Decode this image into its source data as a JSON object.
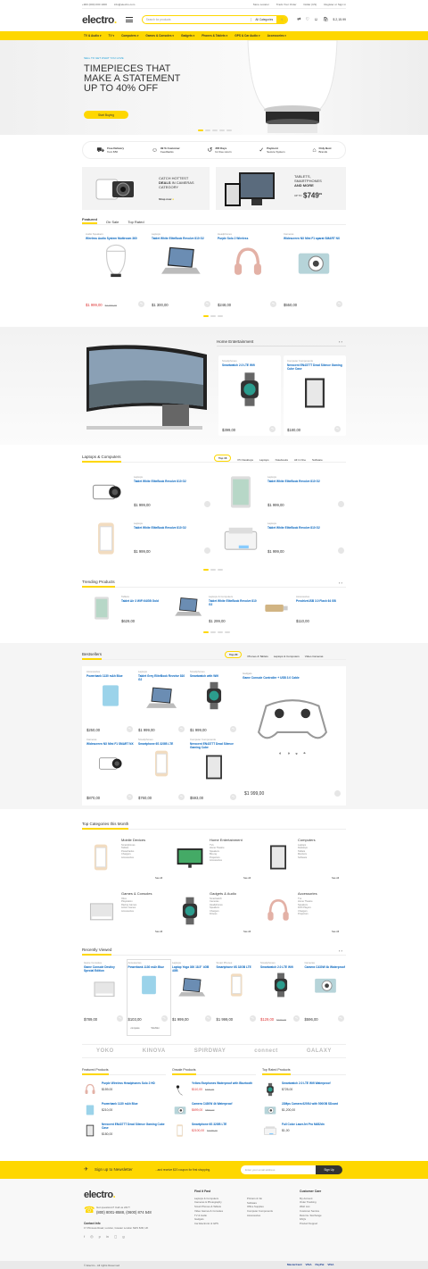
{
  "topbar": {
    "phone": "+900 (000) 000 1000",
    "email": "info@electro.com",
    "store": "Store Locator",
    "track": "Track Your Order",
    "currency": "Dollar (US)",
    "account": "Register  or  Sign in"
  },
  "header": {
    "logo": "electro",
    "search_placeholder": "Search for products",
    "categories": "All Categories",
    "cart_total": "$ 2,15.99",
    "cart_count": "2"
  },
  "nav": [
    "TV & Audio",
    "TV",
    "Computers",
    "Games & Consoles",
    "Gadgets",
    "Phones & Tablets",
    "GPS & Car Audio",
    "Accessories"
  ],
  "hero": {
    "kicker": "SELL TO GET WHAT YOU LOVE",
    "line1": "TIMEPIECES THAT",
    "line2": "MAKE A STATEMENT",
    "line3": "UP TO 40% OFF",
    "button": "Start Buying"
  },
  "features": [
    {
      "icon": "truck-icon",
      "l1": "Free Delivery",
      "l2": "from $50"
    },
    {
      "icon": "feedback-icon",
      "l1": "99 % Customer",
      "l2": "Feedbacks"
    },
    {
      "icon": "return-icon",
      "l1": "365 Days",
      "l2": "for free return"
    },
    {
      "icon": "payment-icon",
      "l1": "Payment",
      "l2": "Secure System"
    },
    {
      "icon": "tag-icon",
      "l1": "Only Best",
      "l2": "Brands"
    }
  ],
  "banners": [
    {
      "t1": "CATCH HOTTEST",
      "t2": "DEALS",
      "t3": " IN CAMERAS",
      "t4": "CATEGORY",
      "cta": "Shop now"
    },
    {
      "t1": "TABLETS,",
      "t2": "SMARTPHONES",
      "t3": "AND MORE",
      "from": "UP TO",
      "price": "$749",
      "cents": "99"
    }
  ],
  "featured": {
    "tabs": [
      "Featured",
      "On Sale",
      "Top Rated"
    ],
    "products": [
      {
        "cat": "Audio Speakers",
        "name": "Wireless Audio System Multiroom 360",
        "price": "$1 999,00",
        "old": "$2 299,00"
      },
      {
        "cat": "Laptops",
        "name": "Tablet White EliteBook Revolve 810 G2",
        "price": "$1 300,00"
      },
      {
        "cat": "Headphones",
        "name": "Purple Solo 2 Wireless",
        "price": "$248,00"
      },
      {
        "cat": "Cameras",
        "name": "Widescreen NX Mini F1 aparat SMART NX",
        "price": "$550,00"
      }
    ]
  },
  "home_ent": {
    "title": "Home Entertainment",
    "products": [
      {
        "cat": "Smartphones",
        "name": "Smartwatch 2.0 LTE Wifi",
        "price": "$399,00"
      },
      {
        "cat": "Computer Components",
        "name": "Nerocent EN4377T Dead Silence Gaming Cube Case",
        "price": "$180,00"
      }
    ]
  },
  "laptops": {
    "title": "Laptops & Computers",
    "tabs": [
      "Top 16",
      "PC Desktops",
      "Laptops",
      "Notebooks",
      "All in One",
      "Software"
    ],
    "products": [
      {
        "cat": "Laptops",
        "name": "Tablet White EliteBook Revolve 810 G2",
        "price": "$1 999,00"
      },
      {
        "cat": "Laptops",
        "name": "Tablet White EliteBook Revolve 810 G2",
        "price": "$1 999,00"
      },
      {
        "cat": "Laptops",
        "name": "Tablet White EliteBook Revolve 810 G2",
        "price": "$1 999,00"
      },
      {
        "cat": "Laptops",
        "name": "Tablet White EliteBook Revolve 810 G2",
        "price": "$1 999,00"
      }
    ]
  },
  "trending": {
    "title": "Trending Products",
    "products": [
      {
        "cat": "Tablets",
        "name": "Tablet Air 3 WiFi 64GB Gold",
        "price": "$629,00"
      },
      {
        "cat": "Laptops & Computers",
        "name": "Tablet White EliteBook Revolve 810 G2",
        "price": "$1 299,00"
      },
      {
        "cat": "Accessories",
        "name": "PendriveUSB 3.0 Flash 64 GB",
        "price": "$110,00"
      }
    ]
  },
  "bestsellers": {
    "title": "Bestsellers",
    "tabs": [
      "Top 20",
      "Phones & Tablets",
      "Laptops & Computers",
      "Video Cameras"
    ],
    "products": [
      {
        "cat": "Accessories",
        "name": "Powerbank 1130 mAh Blue",
        "price": "$250,00"
      },
      {
        "cat": "Laptops",
        "name": "Tablet Grey EliteBook Revolve 810 G2",
        "price": "$1 999,00"
      },
      {
        "cat": "Smartphones",
        "name": "Smartwatch with Wifi",
        "price": "$1 999,00"
      },
      {
        "cat": "Cameras",
        "name": "Widescreen NX Mini F1 SMART NX",
        "price": "$870,00"
      },
      {
        "cat": "Smartphones",
        "name": "Smartphone 6S 32GB LTE",
        "price": "$760,00"
      },
      {
        "cat": "Computer Components",
        "name": "Nerocent EN4377T Dead Silence Gaming Cube",
        "price": "$593,00"
      }
    ],
    "big": {
      "cat": "Gadgets",
      "name": "Game Console Controller + USB 3.0 Cable",
      "price": "$1 999,00"
    }
  },
  "topcats": {
    "title": "Top Categories this Month",
    "cats": [
      {
        "name": "Mobile Devices",
        "links": [
          "Smartphones",
          "Tablets",
          "Powerbanks",
          "Chargers",
          "Accessories"
        ]
      },
      {
        "name": "Home Entertainment",
        "links": [
          "TVs",
          "Home Theatre",
          "Speakers",
          "Blu-ray",
          "Projectors",
          "Accessories"
        ]
      },
      {
        "name": "Computers",
        "links": [
          "Laptops",
          "Desktops",
          "Tablets",
          "Monitors",
          "Software"
        ]
      },
      {
        "name": "Games & Consoles",
        "links": [
          "Xbox",
          "Playstation",
          "Racing Games",
          "Action Games",
          "Accessories"
        ]
      },
      {
        "name": "Gadgets & Audio",
        "links": [
          "Smartwatch",
          "Cameras",
          "Headphones",
          "Speakers",
          "Chargers",
          "Fitness"
        ]
      },
      {
        "name": "Accessories",
        "links": [
          "Tvs",
          "Home Theatre",
          "Speakers",
          "DVD Players",
          "Chargers",
          "Projectors"
        ]
      }
    ],
    "see_all": "See All"
  },
  "recent": {
    "title": "Recently Viewed",
    "products": [
      {
        "cat": "Game Consoles",
        "name": "Game Console Destiny Special Edition",
        "price": "$789,00"
      },
      {
        "cat": "Accessories",
        "name": "Powerbank 1130 mAh Blue",
        "price": "$103,00"
      },
      {
        "cat": "Laptops",
        "name": "Laptop Yoga 300 18.5\" 4GB 4GB",
        "price": "$1 999,00"
      },
      {
        "cat": "Smart Phones",
        "name": "Smartphone 6S 32GB LTE",
        "price": "$1 999,00"
      },
      {
        "cat": "Smartphones",
        "name": "Smartwatch 2.0 LTE Wifi",
        "price": "$129,00",
        "old": "$199,00"
      },
      {
        "cat": "Cameras",
        "name": "Camera C430W 4k Waterproof",
        "price": "$596,00"
      }
    ],
    "compare": "compare",
    "wishlist": "Wishlist"
  },
  "brands": [
    "YOKO",
    "KINOVA",
    "SPIRDWAY",
    "connect",
    "GALAXY"
  ],
  "lists": [
    {
      "title": "Featured Products",
      "items": [
        {
          "name": "Purple Wireless Headphones Solo 2 HD",
          "price": "$159,00"
        },
        {
          "name": "Powerbank 1130 mAh Blue",
          "price": "$210,00"
        },
        {
          "name": "Nerocent EN4377T Dead Silence Gaming Cube Case",
          "price": "$180,00"
        }
      ]
    },
    {
      "title": "Onsale Products",
      "items": [
        {
          "name": "Yellow Earphones Waterproof with Bluetooth",
          "price": "$110,00",
          "old": "$200,00"
        },
        {
          "name": "Camera C430W 4k Waterproof",
          "price": "$699,00",
          "old": "$800,00"
        },
        {
          "name": "Smartphone 6S 32GB LTE",
          "price": "$2100,00",
          "old": "$2299,00"
        }
      ]
    },
    {
      "title": "Top Rated Products",
      "items": [
        {
          "name": "Smartwatch 2.0 LTE Wifi Waterproof",
          "price": "$725,00"
        },
        {
          "name": "22Mps Camera 6200U with 500GB SDcard",
          "price": "$1,200,00"
        },
        {
          "name": "Full Color LaserJet Pro M452dn",
          "price": "$1,00"
        }
      ]
    }
  ],
  "newsletter": {
    "title": "Sign up to Newsletter",
    "text": "...and receive $20 coupon for first shopping.",
    "placeholder": "Enter your email address",
    "button": "Sign Up"
  },
  "footer": {
    "logo": "electro",
    "q": "Got questions? Call us 24/7!",
    "phone": "(800) 8001-8588, (0600) 874 548",
    "contact_h": "Contact Info",
    "address": "17 Princess Road, London, Greater London NW1 8JR, UK",
    "col1": {
      "h": "Find it Fast",
      "links": [
        "Laptops & Computers",
        "Cameras & Photography",
        "Smart Phones & Tablets",
        "Video Games & Consoles",
        "TV & Audio",
        "Gadgets",
        "Car Electronic & GPS"
      ]
    },
    "col2": {
      "links": [
        "Printers & Ink",
        "Software",
        "Office Supplies",
        "Computer Components",
        "Accessories"
      ]
    },
    "col3": {
      "h": "Customer Care",
      "links": [
        "My Account",
        "Order Tracking",
        "Wish List",
        "Customer Service",
        "Returns / Exchange",
        "FAQs",
        "Product Support"
      ]
    }
  },
  "copyright": "© Electro - All rights Reserved",
  "payments": [
    "MasterCard",
    "VISA",
    "PayPal",
    "VISA"
  ]
}
